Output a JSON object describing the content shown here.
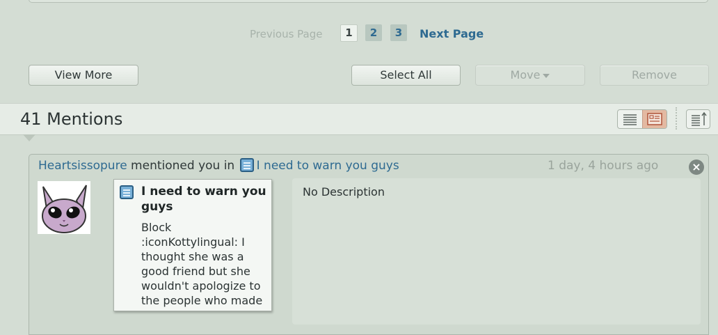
{
  "pagination": {
    "previous_label": "Previous Page",
    "pages": [
      "1",
      "2",
      "3"
    ],
    "current_page": "1",
    "next_label": "Next Page"
  },
  "toolbar": {
    "view_more_label": "View More",
    "select_all_label": "Select All",
    "move_label": "Move",
    "remove_label": "Remove"
  },
  "mentions": {
    "count_title": "41 Mentions"
  },
  "mention_item": {
    "user": "Heartsissopure",
    "verb": " mentioned you in ",
    "deviation_title": "I need to warn you guys",
    "timestamp": "1 day, 4 hours ago",
    "card_title": "I need to warn you guys",
    "card_excerpt": "Block :iconKottylingual: I thought she was a good friend but she wouldn't apologize to the people who made it awkward",
    "description": "No Description"
  },
  "colors": {
    "background": "#d4ddd4",
    "link": "#2e6a91",
    "disabled_text": "#9fa9a3",
    "active_view_toggle": "#e3b9a2"
  },
  "icons": [
    "doc-icon",
    "close-icon",
    "list-view-icon",
    "thumb-view-icon",
    "sort-icon",
    "caret-down-icon"
  ]
}
